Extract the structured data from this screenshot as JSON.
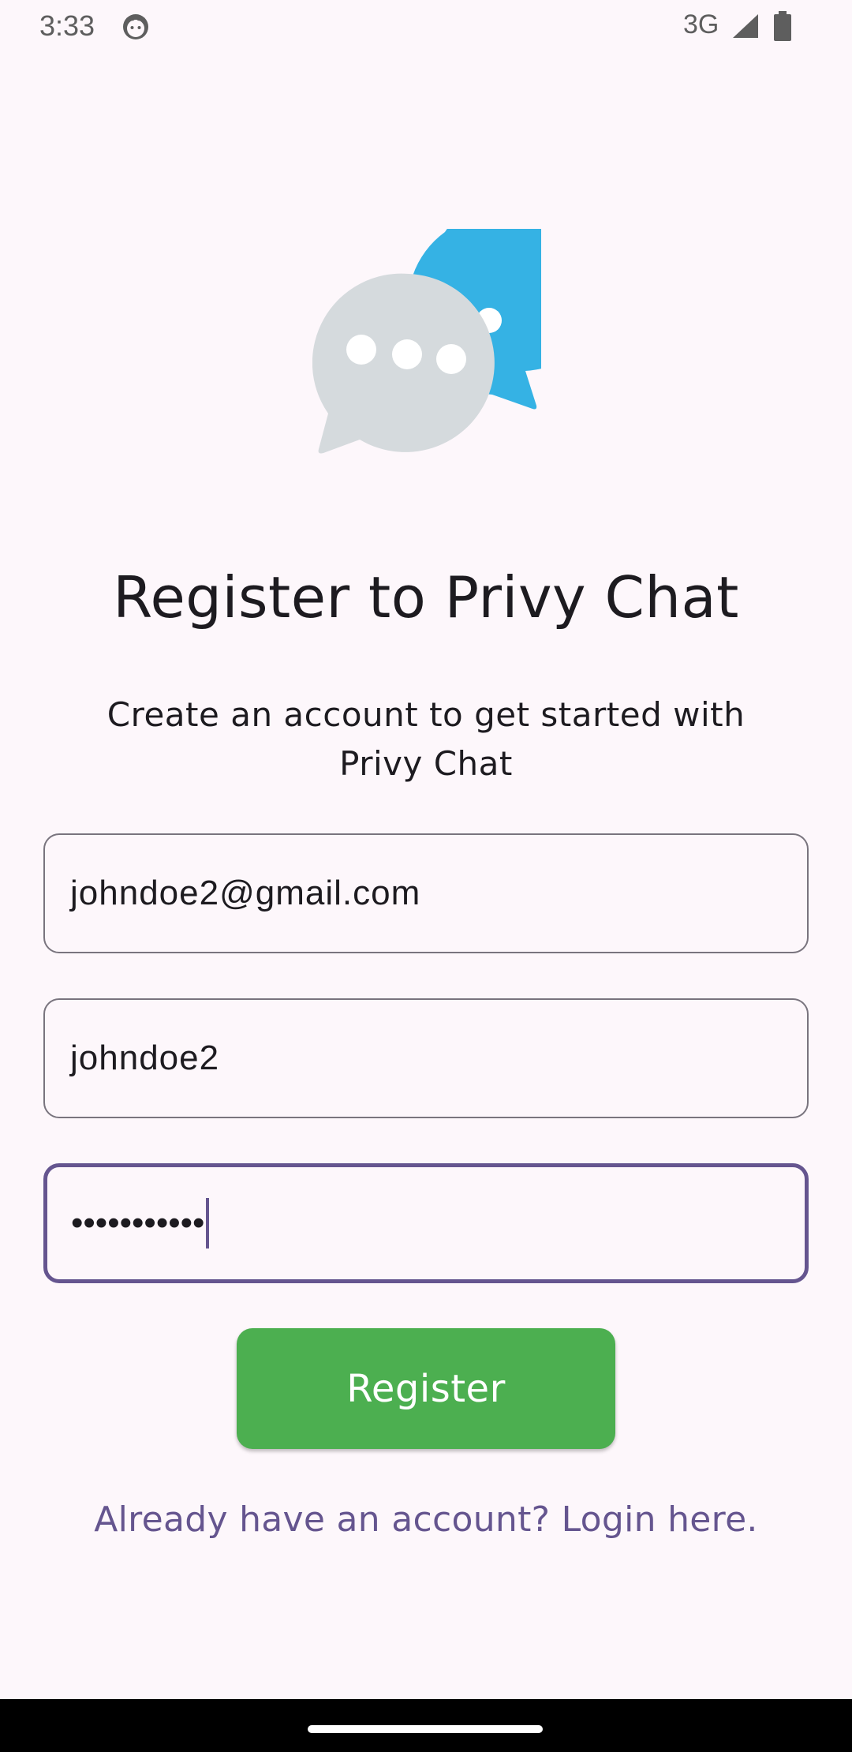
{
  "status_bar": {
    "time": "3:33",
    "network": "3G",
    "icons": [
      "app-notification-icon",
      "signal-icon",
      "battery-icon"
    ]
  },
  "logo": {
    "icon": "chat-bubbles-logo-icon",
    "colors": {
      "back_bubble": "#35b2e4",
      "front_bubble": "#d5dadd",
      "dots": "#ffffff"
    }
  },
  "header": {
    "title": "Register to Privy Chat",
    "subtitle_line1": "Create an account to get started with",
    "subtitle_line2": "Privy Chat"
  },
  "form": {
    "email": {
      "value": "johndoe2@gmail.com"
    },
    "username": {
      "value": "johndoe2"
    },
    "password": {
      "value_masked": "•••••••••••",
      "focused": true
    },
    "register_label": "Register"
  },
  "login_link": "Already have an account? Login here.",
  "colors": {
    "background": "#fdf7fb",
    "primary": "#65558f",
    "button": "#4caf50",
    "outline": "#79747e",
    "text": "#1d1b20"
  }
}
